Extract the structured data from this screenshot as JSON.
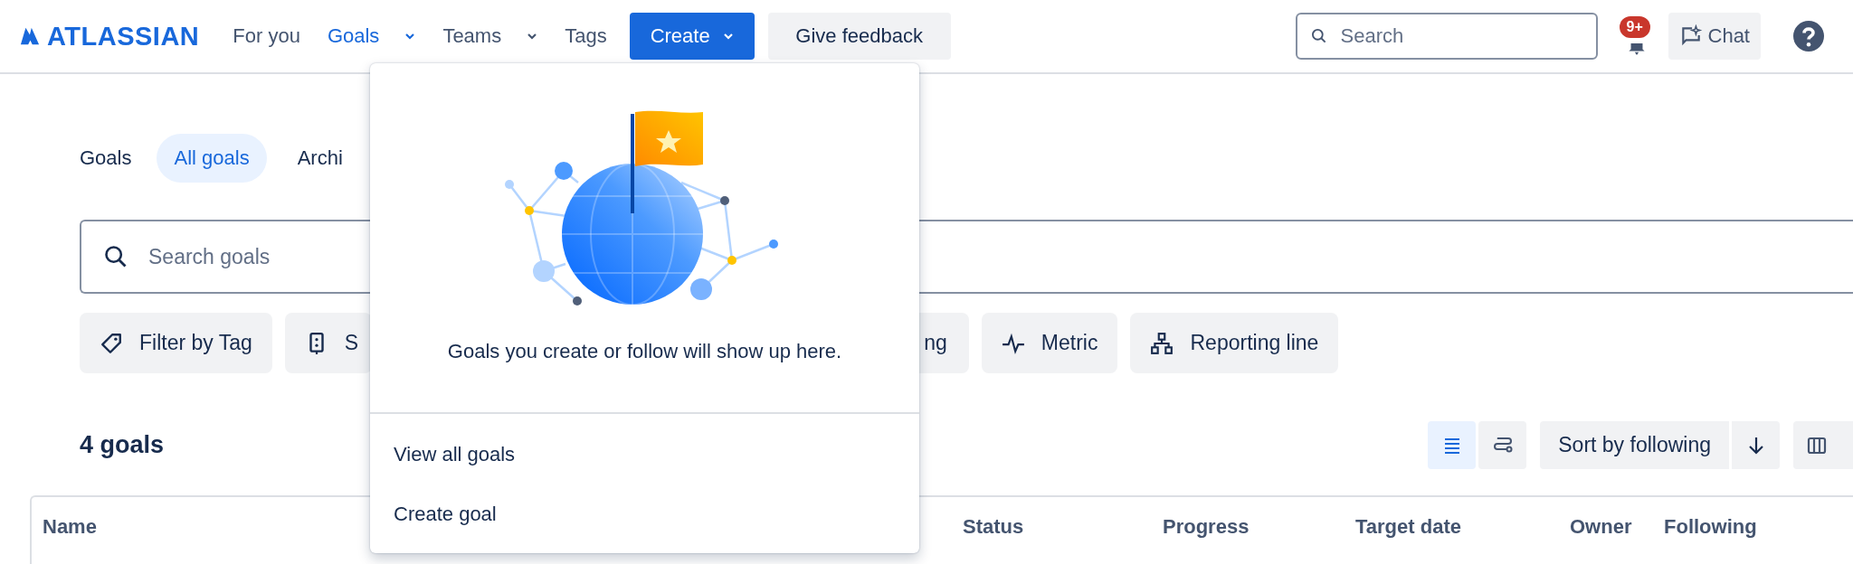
{
  "header": {
    "logo_text": "ATLASSIAN",
    "nav": [
      {
        "label": "For you",
        "selected": false,
        "dropdown": false
      },
      {
        "label": "Goals",
        "selected": true,
        "dropdown": true
      },
      {
        "label": "Teams",
        "selected": false,
        "dropdown": true
      },
      {
        "label": "Tags",
        "selected": false,
        "dropdown": false
      }
    ],
    "create_button": "Create",
    "feedback_button": "Give feedback",
    "search": {
      "placeholder": "Search"
    },
    "notifications_badge": "9+",
    "chat_button": "Chat"
  },
  "tabs": [
    {
      "label": "Goals",
      "selected": false
    },
    {
      "label": "All goals",
      "selected": true
    },
    {
      "label": "Archi",
      "selected": false
    }
  ],
  "search": {
    "placeholder": "Search goals"
  },
  "filters": [
    {
      "label": "Filter by Tag",
      "kind": "tag"
    },
    {
      "label": "S",
      "kind": "status"
    },
    {
      "label": "ng",
      "kind": "text"
    },
    {
      "label": "Metric",
      "kind": "metric"
    },
    {
      "label": "Reporting line",
      "kind": "hierarchy"
    }
  ],
  "count": "4 goals",
  "views": [
    {
      "kind": "list",
      "selected": true
    },
    {
      "kind": "timeline",
      "selected": false
    }
  ],
  "sort": {
    "label": "Sort by following"
  },
  "table": {
    "columns": [
      "Name",
      "Status",
      "Progress",
      "Target date",
      "Owner",
      "Following"
    ]
  },
  "menu": {
    "empty_text": "Goals you create or follow will show up here.",
    "items": [
      "View all goals",
      "Create goal"
    ]
  }
}
